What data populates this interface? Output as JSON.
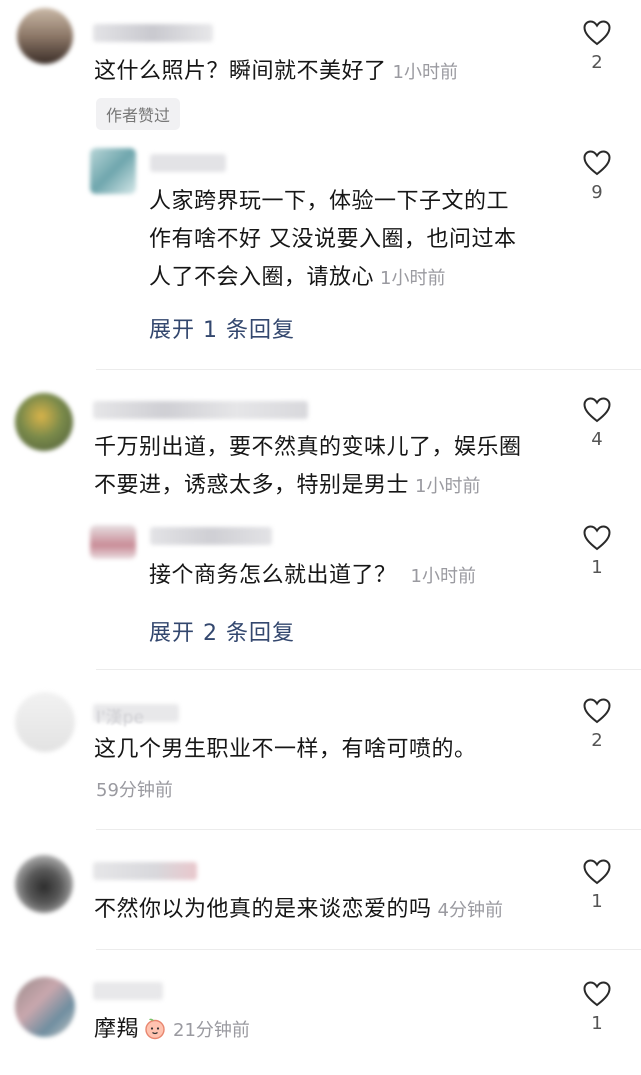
{
  "comments": [
    {
      "text": "这什么照片？瞬间就不美好了",
      "time": "1小时前",
      "likes": "2",
      "badge": "作者赞过",
      "replies": [
        {
          "text_lines": [
            "人家跨界玩一下，体验一下子文的工",
            "作有啥不好 又没说要入圈，也问过本",
            "人了不会入圈，请放心"
          ],
          "time": "1小时前",
          "likes": "9"
        }
      ],
      "expand": "展开 1 条回复"
    },
    {
      "text_lines": [
        "千万别出道，要不然真的变味儿了，娱乐圈",
        "不要进，诱惑太多，特别是男士"
      ],
      "time": "1小时前",
      "likes": "4",
      "replies": [
        {
          "text": "接个商务怎么就出道了？",
          "time": "1小时前",
          "likes": "1"
        }
      ],
      "expand": "展开 2 条回复"
    },
    {
      "name_partial": "I'漢pe",
      "text": "这几个男生职业不一样，有啥可喷的。",
      "time": "59分钟前",
      "likes": "2"
    },
    {
      "text": "不然你以为他真的是来谈恋爱的吗",
      "time": "4分钟前",
      "likes": "1"
    },
    {
      "text": "摩羯",
      "time": "21分钟前",
      "likes": "1",
      "emoji": "peach-face-emoji"
    }
  ],
  "colors": {
    "link": "#33476e",
    "meta": "#9a9aa0"
  }
}
